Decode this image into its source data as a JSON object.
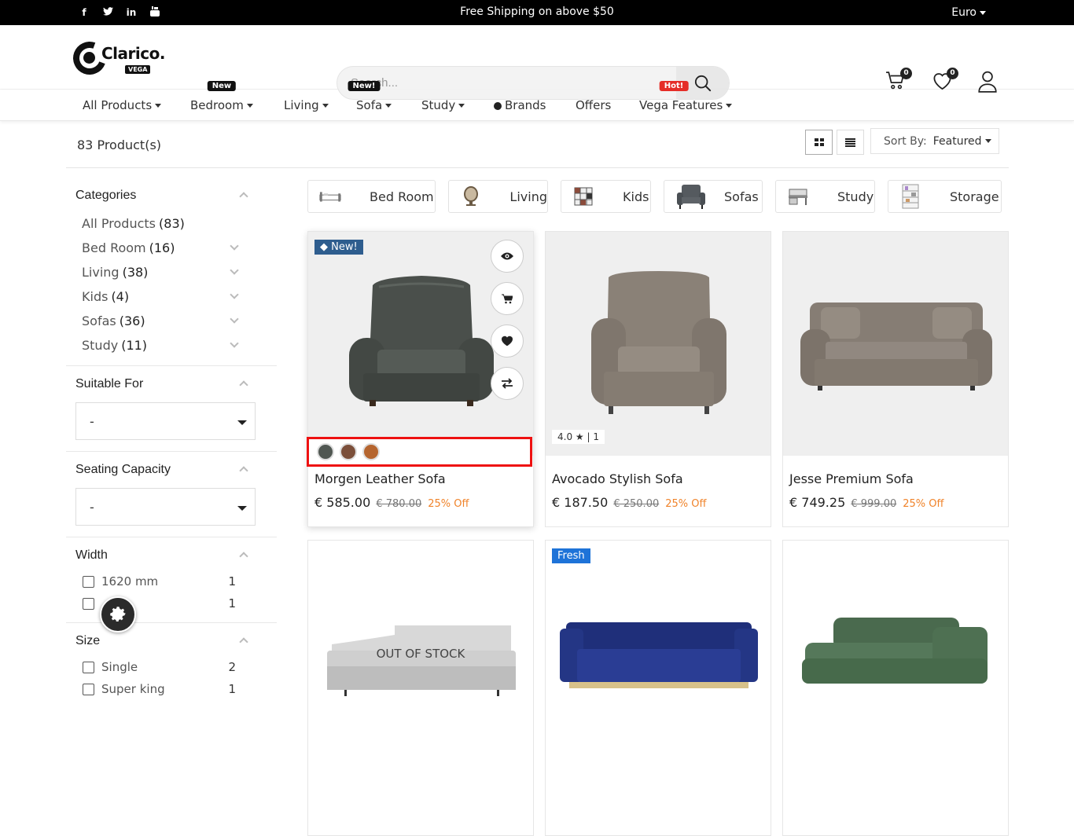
{
  "topbar": {
    "social": [
      "facebook-icon",
      "twitter-icon",
      "linkedin-icon",
      "youtube-icon"
    ],
    "promo": "Free Shipping on above $50",
    "currency": "Euro"
  },
  "header": {
    "logo_text": "Clarico.",
    "logo_sub": "VEGA",
    "search_placeholder": "Search...",
    "cart_count": "0",
    "wishlist_count": "0"
  },
  "nav": {
    "items": [
      {
        "label": "All Products",
        "tag": ""
      },
      {
        "label": "Bedroom",
        "tag": "New"
      },
      {
        "label": "Living",
        "tag": ""
      },
      {
        "label": "Sofa",
        "tag": "New!"
      },
      {
        "label": "Study",
        "tag": ""
      },
      {
        "label": "Brands",
        "tag": ""
      },
      {
        "label": "Offers",
        "tag": ""
      },
      {
        "label": "Vega Features",
        "tag": "Hot!"
      }
    ]
  },
  "toolbar": {
    "count": "83 Product(s)",
    "sort_label": "Sort By:",
    "sort_value": "Featured"
  },
  "sidebar": {
    "categories_title": "Categories",
    "categories": [
      {
        "name": "All Products",
        "count": "(83)"
      },
      {
        "name": "Bed Room",
        "count": "(16)"
      },
      {
        "name": "Living",
        "count": "(38)"
      },
      {
        "name": "Kids",
        "count": "(4)"
      },
      {
        "name": "Sofas",
        "count": "(36)"
      },
      {
        "name": "Study",
        "count": "(11)"
      }
    ],
    "suitable_title": "Suitable For",
    "suitable_value": "-",
    "seating_title": "Seating Capacity",
    "seating_value": "-",
    "width_title": "Width",
    "width_options": [
      {
        "label": "1620 mm",
        "count": "1"
      },
      {
        "label": "...m",
        "count": "1"
      }
    ],
    "size_title": "Size",
    "size_options": [
      {
        "label": "Single",
        "count": "2"
      },
      {
        "label": "Super king",
        "count": "1"
      }
    ]
  },
  "chips": [
    "Bed Room",
    "Living",
    "Kids",
    "Sofas",
    "Study",
    "Storage"
  ],
  "products": [
    {
      "name": "Morgen Leather Sofa",
      "price": "€ 585.00",
      "old": "€ 780.00",
      "off": "25% Off",
      "ribbon": "New!",
      "swatches": [
        "#505752",
        "#7b4f3a",
        "#b5652f"
      ]
    },
    {
      "name": "Avocado Stylish Sofa",
      "price": "€ 187.50",
      "old": "€ 250.00",
      "off": "25% Off",
      "rating": "4.0 ★ | 1"
    },
    {
      "name": "Jesse Premium Sofa",
      "price": "€ 749.25",
      "old": "€ 999.00",
      "off": "25% Off"
    },
    {
      "name": "",
      "oos": "OUT OF STOCK"
    },
    {
      "name": "",
      "ribbon": "Fresh"
    },
    {
      "name": ""
    }
  ]
}
